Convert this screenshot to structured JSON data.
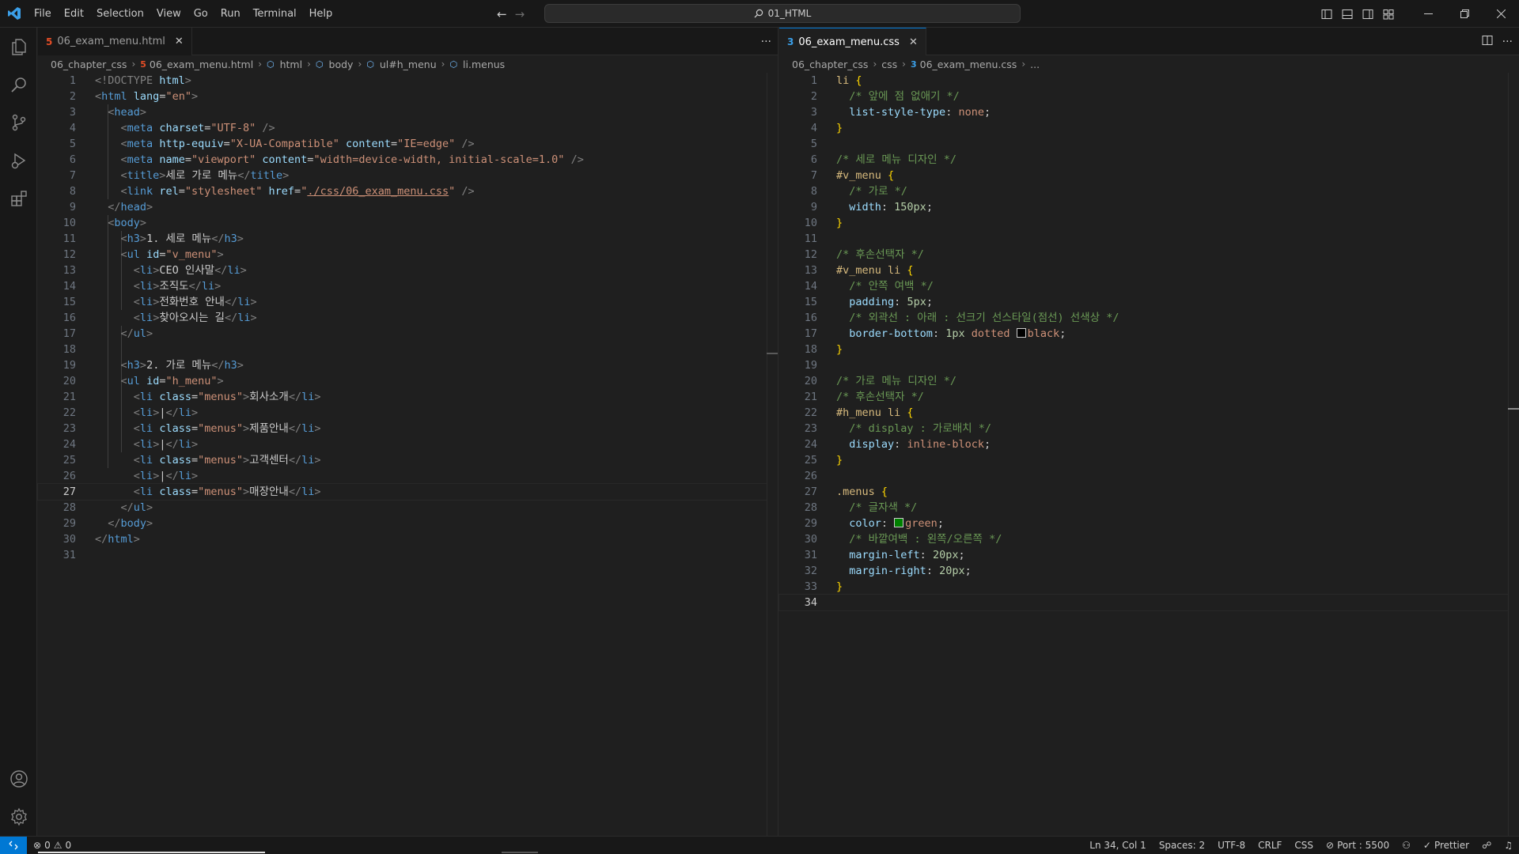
{
  "window": {
    "search_label": "01_HTML",
    "menu": [
      "File",
      "Edit",
      "Selection",
      "View",
      "Go",
      "Run",
      "Terminal",
      "Help"
    ]
  },
  "left_editor": {
    "tab_label": "06_exam_menu.html",
    "breadcrumb": [
      "06_chapter_css",
      "06_exam_menu.html",
      "html",
      "body",
      "ul#h_menu",
      "li.menus"
    ],
    "current_line": 27,
    "line_count": 31
  },
  "right_editor": {
    "tab_label": "06_exam_menu.css",
    "breadcrumb": [
      "06_chapter_css",
      "css",
      "06_exam_menu.css",
      "..."
    ],
    "current_line": 34,
    "line_count": 34
  },
  "html_code": {
    "l1a": "<!DOCTYPE ",
    "l1b": "html",
    "l1c": ">",
    "l2_lang": "\"en\"",
    "l4_charset": "\"UTF-8\"",
    "l5_equiv": "\"X-UA-Compatible\"",
    "l5_content": "\"IE=edge\"",
    "l6_name": "\"viewport\"",
    "l6_content": "\"width=device-width, initial-scale=1.0\"",
    "l7_title": "세로 가로 메뉴",
    "l8_rel": "\"stylesheet\"",
    "l8_href": "./css/06_exam_menu.css",
    "l11_h3": "1. 세로 메뉴",
    "l12_id": "\"v_menu\"",
    "l13_li": "CEO 인사말",
    "l14_li": "조직도",
    "l15_li": "전화번호 안내",
    "l16_li": "찾아오시는 길",
    "l19_h3": "2. 가로 메뉴",
    "l20_id": "\"h_menu\"",
    "class_menus": "\"menus\"",
    "l21_li": "회사소개",
    "sep_li": "|",
    "l23_li": "제품안내",
    "l25_li": "고객센터",
    "l27_li": "매장안내"
  },
  "css_code": {
    "sel_li": "li",
    "c2": "/* 앞에 점 없애기 */",
    "p_list_style": "list-style-type",
    "v_none": "none",
    "c6": "/* 세로 메뉴 디자인 */",
    "sel_vmenu": "#v_menu",
    "c8": "/* 가로 */",
    "p_width": "width",
    "v_150": "150px",
    "c12": "/* 후손선택자 */",
    "sel_vmenu_li": "#v_menu li",
    "c14": "/* 안쪽 여백 */",
    "p_padding": "padding",
    "v_5": "5px",
    "c16": "/* 외곽선 : 아래 : 선크기 선스타일(점선) 선색상 */",
    "p_border_bottom": "border-bottom",
    "v_1px": "1px",
    "v_dotted": "dotted",
    "v_black": "black",
    "c20": "/* 가로 메뉴 디자인 */",
    "c21": "/* 후손선택자 */",
    "sel_hmenu_li": "#h_menu li",
    "c23": "/* display : 가로배치 */",
    "p_display": "display",
    "v_inline_block": "inline-block",
    "sel_menus": ".menus",
    "c28": "/* 글자색 */",
    "p_color": "color",
    "v_green": "green",
    "c30": "/* 바깥여백 : 왼쪽/오른쪽 */",
    "p_margin_left": "margin-left",
    "v_20": "20px",
    "p_margin_right": "margin-right"
  },
  "status": {
    "errors": "0",
    "warnings": "0",
    "position": "Ln 34, Col 1",
    "spaces": "Spaces: 2",
    "encoding": "UTF-8",
    "eol": "CRLF",
    "language": "CSS",
    "port": "Port : 5500",
    "prettier": "Prettier"
  },
  "colors": {
    "accent": "#0078d4",
    "swatch_black": "#000000",
    "swatch_green": "#008000"
  },
  "icons": [
    "vscode-logo-icon",
    "explorer-icon",
    "search-icon",
    "source-control-icon",
    "run-debug-icon",
    "extensions-icon",
    "accounts-icon",
    "manage-gear-icon"
  ]
}
